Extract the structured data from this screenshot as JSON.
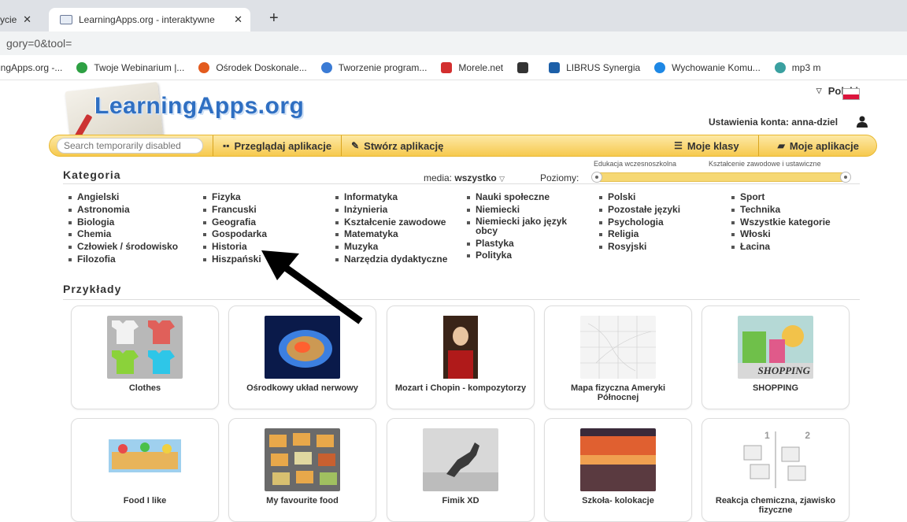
{
  "browser": {
    "tabs": [
      {
        "label": "ycie",
        "close": "✕"
      },
      {
        "label": "LearningApps.org - interaktywne",
        "close": "✕"
      }
    ],
    "new_tab": "+",
    "url": "gory=0&tool=",
    "bookmarks": [
      {
        "label": "ingApps.org -...",
        "icon": "none",
        "color": "#ffffff"
      },
      {
        "label": "Twoje Webinarium |...",
        "icon": "webinarium-icon",
        "color": "#2ea043"
      },
      {
        "label": "Ośrodek Doskonale...",
        "icon": "osrodek-icon",
        "color": "#e35b1e"
      },
      {
        "label": "Tworzenie program...",
        "icon": "tworzenie-icon",
        "color": "#3a7bd5"
      },
      {
        "label": "Morele.net",
        "icon": "morele-icon",
        "color": "#d32f2f"
      },
      {
        "label": "",
        "icon": "dark-square-icon",
        "color": "#333333"
      },
      {
        "label": "LIBRUS Synergia",
        "icon": "librus-icon",
        "color": "#1c5fa8"
      },
      {
        "label": "Wychowanie Komu...",
        "icon": "wychowanie-icon",
        "color": "#1e88e5"
      },
      {
        "label": "mp3 m",
        "icon": "mp3-icon",
        "color": "#3aa0a0"
      }
    ]
  },
  "site": {
    "logo": "LearningApps.org",
    "language": "Polski",
    "account": "Ustawienia konta: anna-dziel",
    "search_placeholder": "Search temporarily disabled",
    "nav": {
      "browse": "Przeglądaj aplikacje",
      "create": "Stwórz aplikację",
      "classes": "Moje klasy",
      "apps": "Moje aplikacje"
    },
    "category_title": "Kategoria",
    "media_label": "media:",
    "media_value": "wszystko",
    "levels_label": "Poziomy:",
    "level_min": "Edukacja wczesnoszkolna",
    "level_max": "Kształcenie zawodowe i ustawiczne",
    "categories": [
      [
        "Angielski",
        "Astronomia",
        "Biologia",
        "Chemia",
        "Człowiek / środowisko",
        "Filozofia"
      ],
      [
        "Fizyka",
        "Francuski",
        "Geografia",
        "Gospodarka",
        "Historia",
        "Hiszpański"
      ],
      [
        "Informatyka",
        "Inżynieria",
        "Kształcenie zawodowe",
        "Matematyka",
        "Muzyka",
        "Narzędzia dydaktyczne"
      ],
      [
        "Nauki społeczne",
        "Niemiecki",
        "Niemiecki jako język obcy",
        "Plastyka",
        "Polityka"
      ],
      [
        "Polski",
        "Pozostałe języki",
        "Psychologia",
        "Religia",
        "Rosyjski"
      ],
      [
        "Sport",
        "Technika",
        "Wszystkie kategorie",
        "Włoski",
        "Łacina"
      ]
    ],
    "examples_title": "Przykłady",
    "examples": [
      {
        "label": "Clothes",
        "thumb": "clothes-thumb"
      },
      {
        "label": "Ośrodkowy układ nerwowy",
        "thumb": "brain-thumb"
      },
      {
        "label": "Mozart i Chopin - kompozytorzy",
        "thumb": "mozart-thumb"
      },
      {
        "label": "Mapa fizyczna Ameryki Północnej",
        "thumb": "map-thumb"
      },
      {
        "label": "SHOPPING",
        "thumb": "shopping-thumb"
      },
      {
        "label": "Food I like",
        "thumb": "food-like-thumb"
      },
      {
        "label": "My favourite food",
        "thumb": "favourite-food-thumb"
      },
      {
        "label": "Fimik XD",
        "thumb": "horse-thumb"
      },
      {
        "label": "Szkoła- kolokacje",
        "thumb": "sunset-thumb"
      },
      {
        "label": "Reakcja chemiczna, zjawisko fizyczne",
        "thumb": "reaction-thumb"
      }
    ],
    "shopping_text": "SHOPPING",
    "reaction_nums": [
      "1",
      "2"
    ]
  }
}
